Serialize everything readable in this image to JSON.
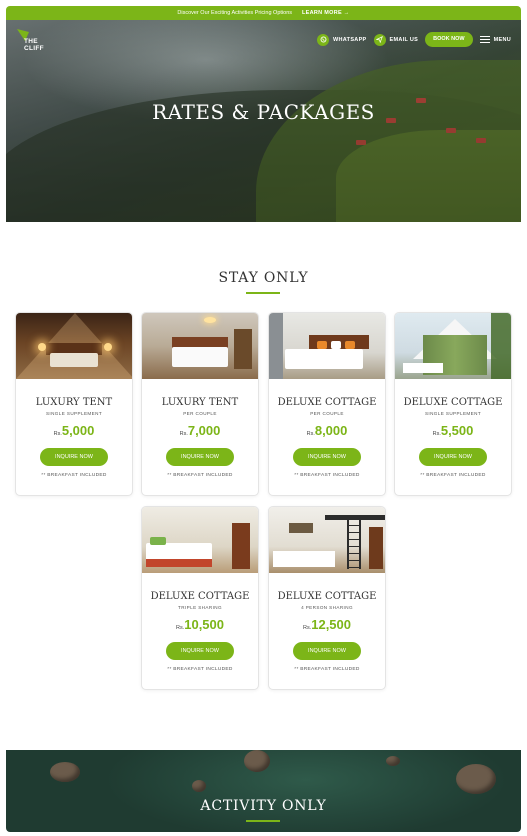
{
  "promo": {
    "text": "Discover Our Exciting Activities Pricing Options",
    "link": "LEARN MORE →"
  },
  "logo": {
    "text_line1": "THE",
    "text_line2": "CLIFF"
  },
  "nav": {
    "whatsapp": "WHATSAPP",
    "email": "EMAIL US",
    "book": "BOOK NOW",
    "menu": "MENU"
  },
  "hero": {
    "title": "RATES & PACKAGES"
  },
  "stay": {
    "title": "STAY ONLY",
    "cards": [
      {
        "name": "LUXURY TENT",
        "sub": "SINGLE SUPPLEMENT",
        "currency": "Rs.",
        "price": "5,000",
        "button": "INQUIRE NOW",
        "note": "** BREAKFAST INCLUDED"
      },
      {
        "name": "LUXURY TENT",
        "sub": "PER COUPLE",
        "currency": "Rs.",
        "price": "7,000",
        "button": "INQUIRE NOW",
        "note": "** BREAKFAST INCLUDED"
      },
      {
        "name": "DELUXE COTTAGE",
        "sub": "PER COUPLE",
        "currency": "Rs.",
        "price": "8,000",
        "button": "INQUIRE NOW",
        "note": "** BREAKFAST INCLUDED"
      },
      {
        "name": "DELUXE COTTAGE",
        "sub": "SINGLE SUPPLEMENT",
        "currency": "Rs.",
        "price": "5,500",
        "button": "INQUIRE NOW",
        "note": "** BREAKFAST INCLUDED"
      },
      {
        "name": "DELUXE COTTAGE",
        "sub": "TRIPLE SHARING",
        "currency": "Rs.",
        "price": "10,500",
        "button": "INQUIRE NOW",
        "note": "** BREAKFAST INCLUDED"
      },
      {
        "name": "DELUXE COTTAGE",
        "sub": "4 PERSON SHARING",
        "currency": "Rs.",
        "price": "12,500",
        "button": "INQUIRE NOW",
        "note": "** BREAKFAST INCLUDED"
      }
    ]
  },
  "activity": {
    "title": "ACTIVITY ONLY"
  },
  "colors": {
    "accent": "#7cb518",
    "text": "#333333"
  },
  "icons": [
    "leaf-logo-icon",
    "whatsapp-icon",
    "send-icon",
    "menu-icon"
  ]
}
